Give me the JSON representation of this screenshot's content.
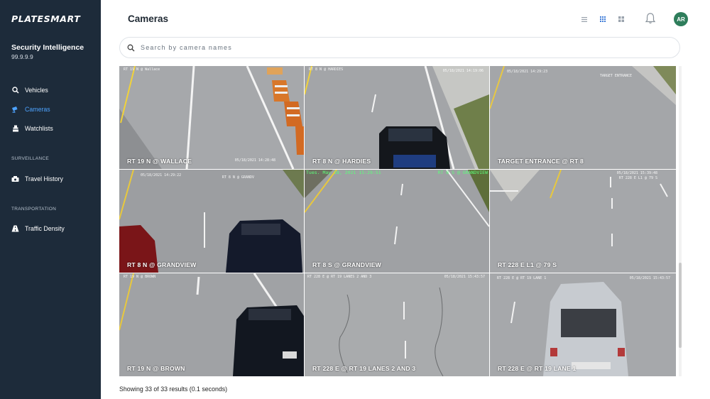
{
  "sidebar": {
    "logo": "PLATESMART",
    "org_name": "Security Intelligence",
    "org_version": "99.9.9.9",
    "nav": [
      {
        "label": "Vehicles",
        "icon": "search-icon",
        "active": false
      },
      {
        "label": "Cameras",
        "icon": "camera-icon",
        "active": true
      },
      {
        "label": "Watchlists",
        "icon": "watchlist-icon",
        "active": false
      }
    ],
    "sections": [
      {
        "title": "SURVEILLANCE",
        "items": [
          {
            "label": "Travel History",
            "icon": "route-icon"
          }
        ]
      },
      {
        "title": "TRANSPORTATION",
        "items": [
          {
            "label": "Traffic Density",
            "icon": "road-icon"
          }
        ]
      }
    ]
  },
  "header": {
    "title": "Cameras",
    "view_modes": [
      "list-view-icon",
      "grid-view-icon",
      "large-grid-view-icon"
    ],
    "active_view": "grid-view-icon",
    "avatar_initials": "AR"
  },
  "search": {
    "placeholder": "Search by camera names",
    "value": ""
  },
  "cameras": [
    {
      "label": "RT 19 N @ WALLACE",
      "stamp_top": "RT 19 N @ Wallace",
      "stamp_bottom": "05/18/2021 14:28:48"
    },
    {
      "label": "RT 8 N @ HARDIES",
      "stamp_top": "RT 8 N @ HARDIES",
      "stamp_bottom": "05/18/2021 14:19:06"
    },
    {
      "label": "TARGET ENTRANCE @ RT 8",
      "stamp_top": "05/18/2021 14:29:23",
      "stamp_bottom": "TARGET ENTRANCE"
    },
    {
      "label": "RT 8 N @ GRANDVIEW",
      "stamp_top": "05/18/2021 14:29:22",
      "stamp_bottom": "RT 8 N @ GRANDV"
    },
    {
      "label": "RT 8 S @ GRANDVIEW",
      "stamp_top": "Tues. May 18, 2021 15:29:51",
      "stamp_bottom": "RT 8 S @ GRANDVIEW"
    },
    {
      "label": "RT 228 E L1 @ 79 S",
      "stamp_top": "05/18/2021 15:39:48",
      "stamp_bottom": "RT 228 E L1 @ 79 S"
    },
    {
      "label": "RT 19 N @ BROWN",
      "stamp_top": "RT 19 N @ BROWN",
      "stamp_bottom": ""
    },
    {
      "label": "RT 228 E @ RT 19 LANES 2 AND 3",
      "stamp_top": "RT 228 E @ RT 19 LANES 2 AND 3",
      "stamp_bottom": "05/18/2021 15:43:57"
    },
    {
      "label": "RT 228 E @ RT 19 LANE 1",
      "stamp_top": "RT 228 E @ RT 19 LANE 1",
      "stamp_bottom": "05/18/2021 15:43:57"
    }
  ],
  "results_text": "Showing 33 of 33 results (0.1 seconds)",
  "colors": {
    "sidebar_bg": "#1d2b3a",
    "active_nav": "#4da3ff",
    "accent": "#3d7bd8",
    "avatar_bg": "#2e7d5b"
  }
}
